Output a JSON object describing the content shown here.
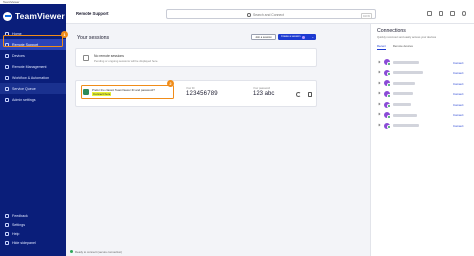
{
  "window": {
    "title": "TeamViewer"
  },
  "brand": {
    "name": "TeamViewer",
    "accent": "#1d3bd1",
    "sidebar_bg": "#0a1e7a",
    "highlight": "#f08c19"
  },
  "sidebar": {
    "items": [
      {
        "label": "Home",
        "icon": "home-icon"
      },
      {
        "label": "Remote Support",
        "icon": "remote-support-icon",
        "active": true
      },
      {
        "label": "Devices",
        "icon": "devices-icon"
      },
      {
        "label": "Remote Management",
        "icon": "remote-management-icon"
      },
      {
        "label": "Workflow & Automation",
        "icon": "workflow-icon"
      },
      {
        "label": "Service Queue",
        "icon": "service-queue-icon"
      },
      {
        "label": "Admin settings",
        "icon": "admin-settings-icon"
      }
    ],
    "bottom": [
      {
        "label": "Feedback",
        "icon": "feedback-icon"
      },
      {
        "label": "Settings",
        "icon": "settings-icon"
      },
      {
        "label": "Help",
        "icon": "help-icon"
      },
      {
        "label": "Hide sidepanel",
        "icon": "hide-sidepanel-icon"
      }
    ],
    "badge": "1"
  },
  "header": {
    "page_title": "Remote Support",
    "search_placeholder": "Search and Connect",
    "search_shortcut": "Ctrl K"
  },
  "sessions": {
    "title": "Your sessions",
    "join_button": "Join a session",
    "create_button": "Create a session",
    "empty_title": "No remote sessions",
    "empty_sub": "Pending or ongoing sessions will be displayed here."
  },
  "quick_connect": {
    "prompt": "Prefer the classic TeamViewer ID and password?",
    "link": "Connect here",
    "badge": "2",
    "id_label": "Your ID",
    "id_value": "123456789",
    "password_label": "Your password",
    "password_value": "123 abc"
  },
  "status": {
    "text": "Ready to connect (secure connection)"
  },
  "connections": {
    "title": "Connections",
    "subtitle": "Quickly reconnect and easily access your devices",
    "tabs": [
      "Recent",
      "Remote devices"
    ],
    "connect_label": "Connect",
    "devices": [
      {
        "connect": "Connect"
      },
      {
        "connect": "Connect"
      },
      {
        "connect": "Connect"
      },
      {
        "connect": "Connect"
      },
      {
        "connect": "Connect"
      },
      {
        "connect": "Connect"
      },
      {
        "connect": "Connect"
      }
    ]
  }
}
